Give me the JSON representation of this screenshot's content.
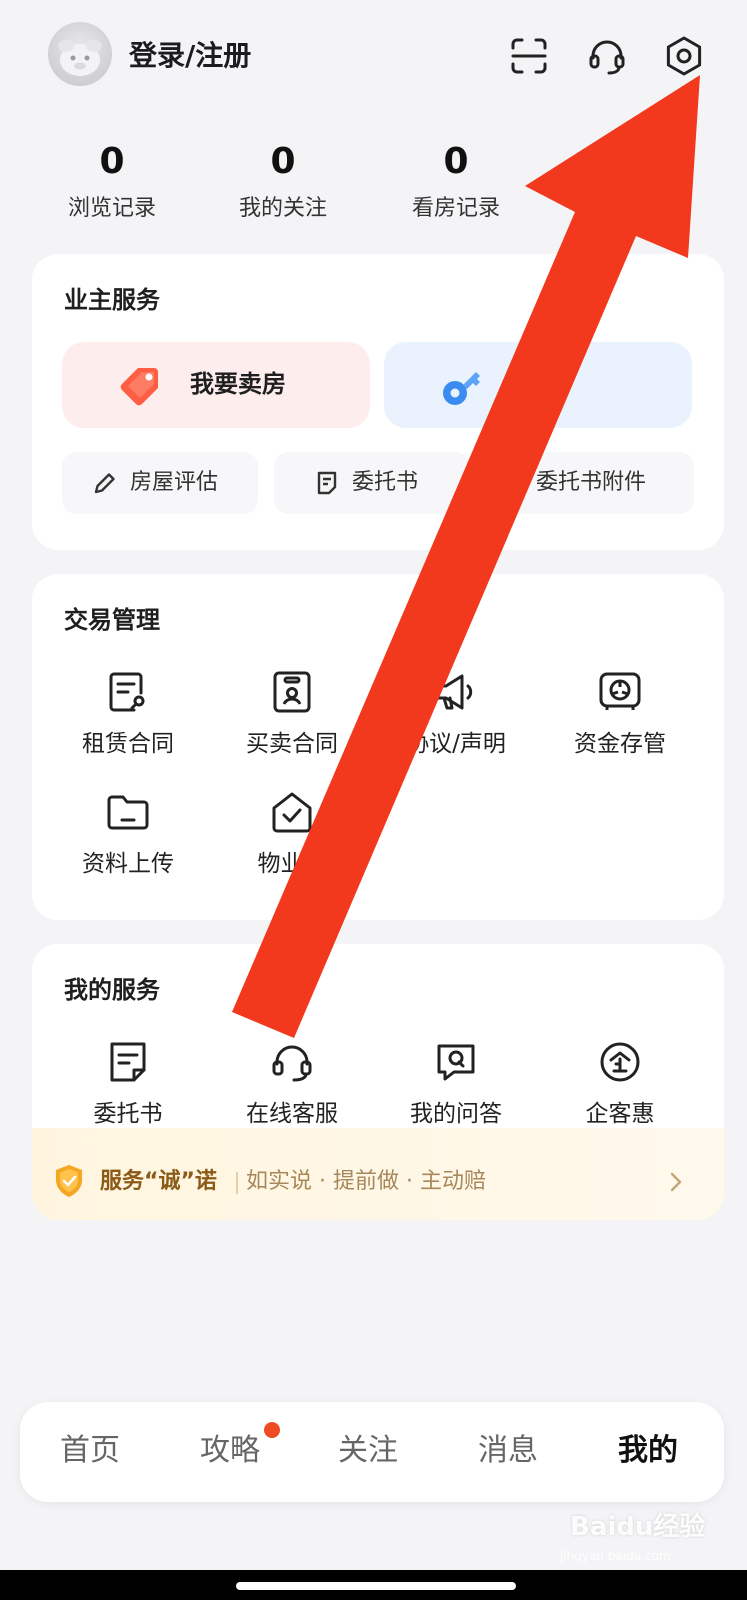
{
  "header": {
    "login_label": "登录/注册",
    "icons": [
      "scan-icon",
      "headset-icon",
      "settings-icon"
    ]
  },
  "stats": [
    {
      "value": "0",
      "label": "浏览记录"
    },
    {
      "value": "0",
      "label": "我的关注"
    },
    {
      "value": "0",
      "label": "看房记录"
    }
  ],
  "owner_services": {
    "title": "业主服务",
    "sell": "我要卖房",
    "rent": "出租",
    "evaluate": "房屋评估",
    "commission": "委托书",
    "attachment": "委托书附件"
  },
  "trade": {
    "title": "交易管理",
    "items": [
      "租赁合同",
      "买卖合同",
      "协议/声明",
      "资金存管",
      "资料上传",
      "物业交"
    ]
  },
  "my_services": {
    "title": "我的服务",
    "items": [
      "委托书",
      "在线客服",
      "我的问答",
      "企客惠"
    ]
  },
  "promise": {
    "title": "服务“诚”诺",
    "desc": "如实说 · 提前做 · 主动赔"
  },
  "tabbar": {
    "tabs": [
      "首页",
      "攻略",
      "关注",
      "消息",
      "我的"
    ],
    "active": "我的"
  },
  "watermark": {
    "brand": "Baidu经验",
    "url": "jingyan.baidu.com"
  },
  "colors": {
    "accent_red": "#f2391d",
    "sell_bg": "#fdeeed",
    "rent_bg": "#eaf2fd",
    "promise_text": "#8a5a16"
  }
}
